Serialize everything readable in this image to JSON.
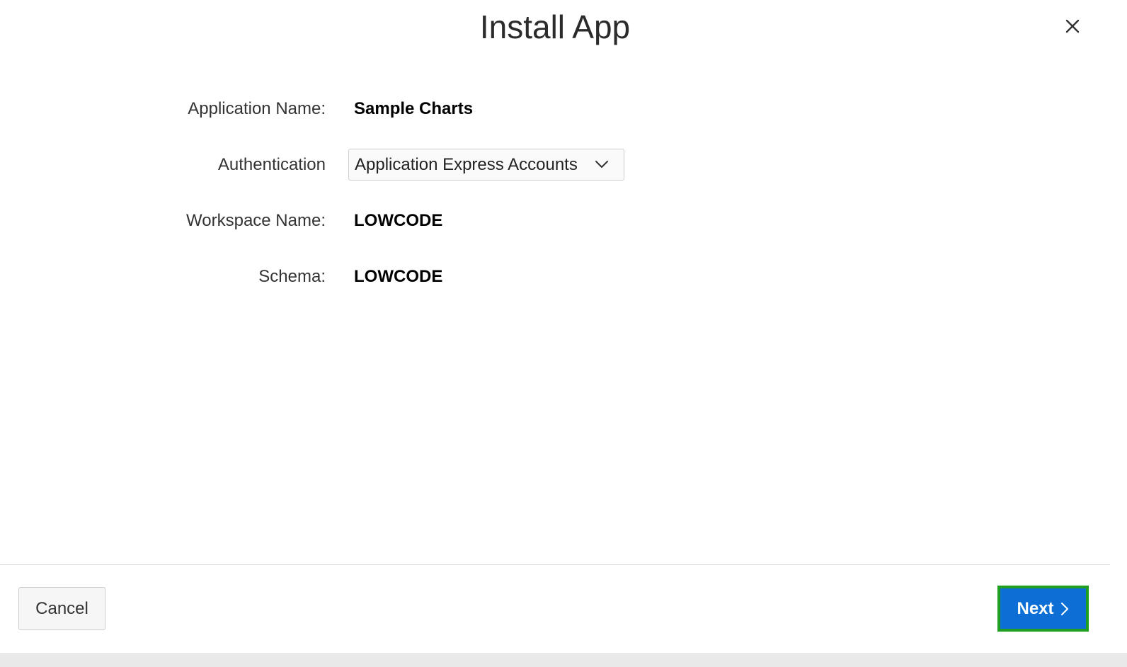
{
  "dialog": {
    "title": "Install App",
    "close_icon": "close-icon"
  },
  "form": {
    "application_name": {
      "label": "Application Name:",
      "value": "Sample Charts"
    },
    "authentication": {
      "label": "Authentication",
      "selected": "Application Express Accounts",
      "icon": "chevron-down-icon"
    },
    "workspace_name": {
      "label": "Workspace Name:",
      "value": "LOWCODE"
    },
    "schema": {
      "label": "Schema:",
      "value": "LOWCODE"
    }
  },
  "footer": {
    "cancel_label": "Cancel",
    "next_label": "Next",
    "next_icon": "chevron-right-icon"
  },
  "colors": {
    "primary": "#0d6fd6",
    "highlight": "#1f9e1f"
  }
}
